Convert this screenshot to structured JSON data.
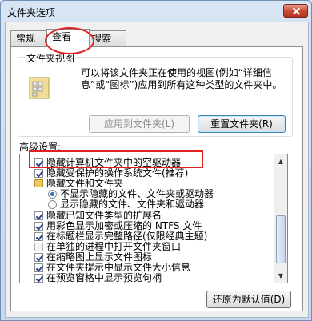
{
  "window": {
    "title": "文件夹选项"
  },
  "tabs": [
    {
      "label": "常规"
    },
    {
      "label": "查看"
    },
    {
      "label": "搜索"
    }
  ],
  "folder_view": {
    "group_label": "文件夹视图",
    "description": "可以将该文件夹正在使用的视图(例如“详细信息”或“图标”)应用到所有这种类型的文件夹中。",
    "apply_button": "应用到文件夹(L)",
    "reset_button": "重置文件夹(R)"
  },
  "advanced": {
    "label": "高级设置:",
    "items": [
      {
        "type": "checkbox",
        "checked": true,
        "indent": 0,
        "label": "隐藏计算机文件夹中的空驱动器"
      },
      {
        "type": "checkbox",
        "checked": true,
        "indent": 0,
        "label": "隐藏受保护的操作系统文件(推荐)"
      },
      {
        "type": "folder",
        "indent": 0,
        "label": "隐藏文件和文件夹"
      },
      {
        "type": "radio",
        "checked": true,
        "indent": 1,
        "label": "不显示隐藏的文件、文件夹或驱动器"
      },
      {
        "type": "radio",
        "checked": false,
        "indent": 1,
        "label": "显示隐藏的文件、文件夹和驱动器"
      },
      {
        "type": "checkbox",
        "checked": true,
        "indent": 0,
        "label": "隐藏已知文件类型的扩展名"
      },
      {
        "type": "checkbox",
        "checked": true,
        "indent": 0,
        "label": "用彩色显示加密或压缩的 NTFS 文件"
      },
      {
        "type": "checkbox",
        "checked": true,
        "indent": 0,
        "label": "在标题栏显示完整路径(仅限经典主题)"
      },
      {
        "type": "checkbox",
        "checked": false,
        "indent": 0,
        "label": "在单独的进程中打开文件夹窗口"
      },
      {
        "type": "checkbox",
        "checked": true,
        "indent": 0,
        "label": "在缩略图上显示文件图标"
      },
      {
        "type": "checkbox",
        "checked": true,
        "indent": 0,
        "label": "在文件夹提示中显示文件大小信息"
      },
      {
        "type": "checkbox",
        "checked": true,
        "indent": 0,
        "label": "在预览窗格中显示预览句柄"
      }
    ]
  },
  "restore_button": "还原为默认值(D)"
}
